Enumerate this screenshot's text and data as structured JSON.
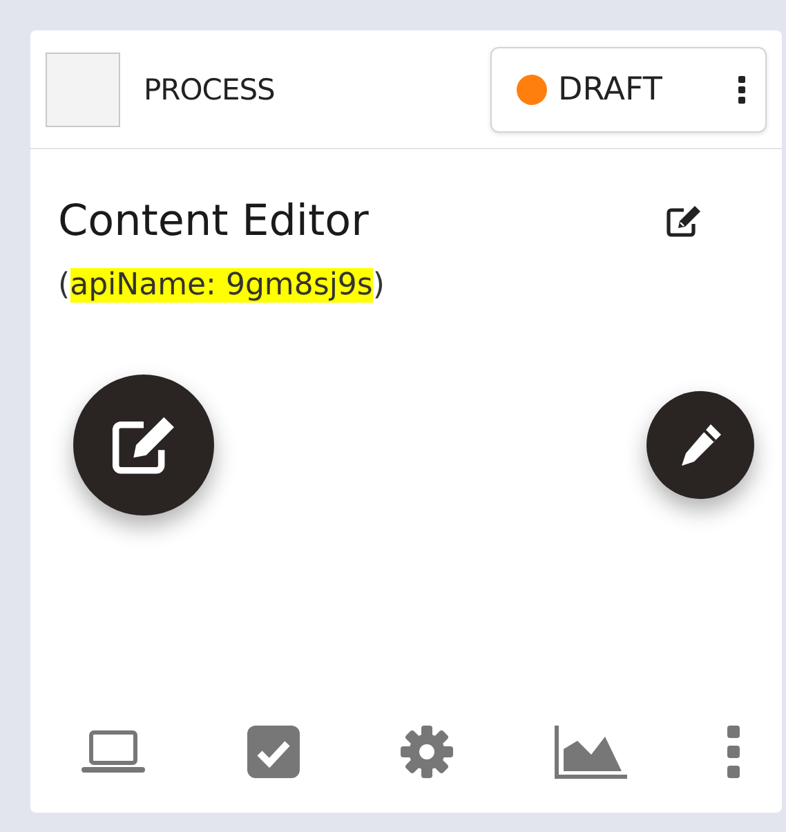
{
  "header": {
    "select_box": {
      "checked": false
    },
    "type_label": "PROCESS",
    "status": {
      "label": "DRAFT",
      "color": "#ff7f0e"
    }
  },
  "card": {
    "title": "Content Editor",
    "api_name": [
      {
        "text": "(",
        "highlighted": false
      },
      {
        "text": "apiName: 9gm8sj9s",
        "highlighted": true
      },
      {
        "text": ")",
        "highlighted": false
      }
    ]
  }
}
